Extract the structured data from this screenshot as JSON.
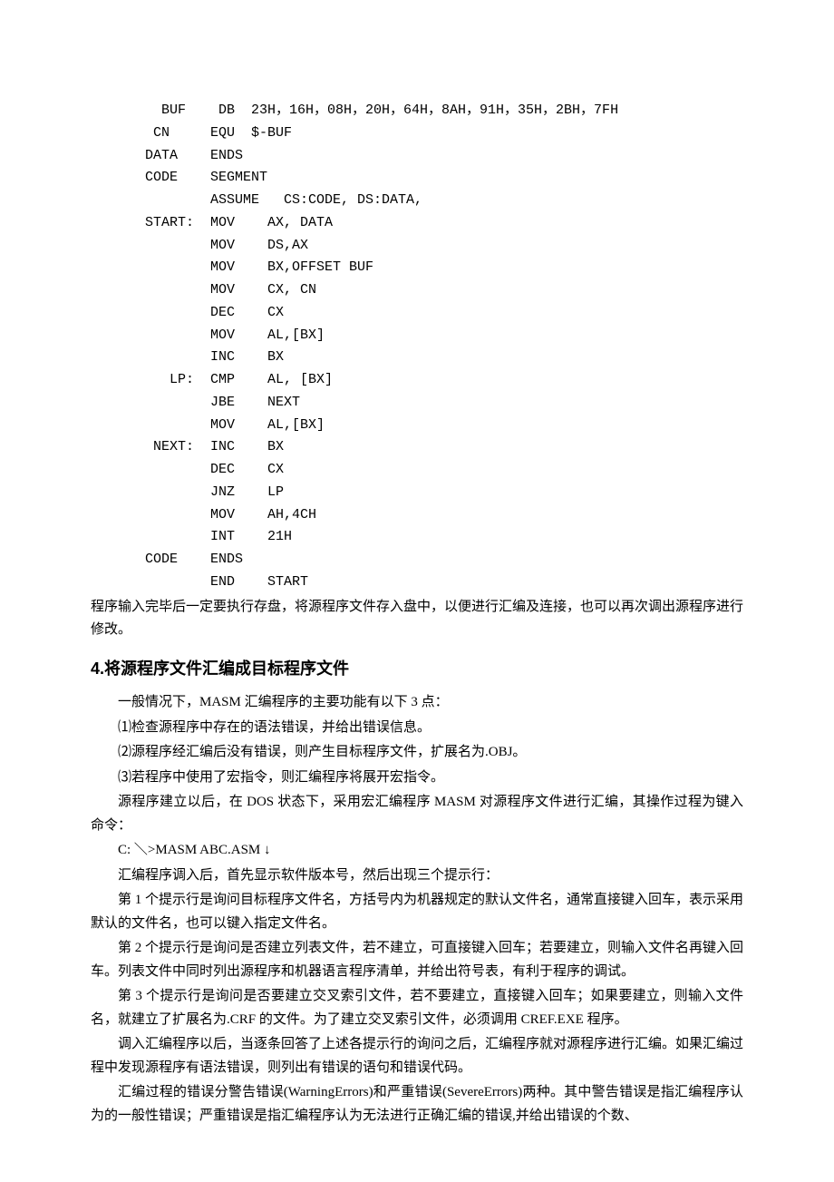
{
  "code": {
    "l1": "  BUF    DB  23H，16H，08H，20H，64H，8AH，91H，35H，2BH，7FH",
    "l2": " CN     EQU  $-BUF",
    "l3": "DATA    ENDS",
    "l4": "CODE    SEGMENT",
    "l5": "        ASSUME   CS:CODE, DS:DATA,",
    "l6": "START:  MOV    AX, DATA",
    "l7": "        MOV    DS,AX",
    "l8": "        MOV    BX,OFFSET BUF",
    "l9": "        MOV    CX, CN",
    "l10": "        DEC    CX",
    "l11": "        MOV    AL,[BX]",
    "l12": "        INC    BX",
    "l13": "   LP:  CMP    AL, [BX]",
    "l14": "        JBE    NEXT",
    "l15": "        MOV    AL,[BX]",
    "l16": " NEXT:  INC    BX",
    "l17": "        DEC    CX",
    "l18": "        JNZ    LP",
    "l19": "        MOV    AH,4CH",
    "l20": "        INT    21H",
    "l21": "CODE    ENDS",
    "l22": "        END    START"
  },
  "p1": "程序输入完毕后一定要执行存盘，将源程序文件存入盘中，以便进行汇编及连接，也可以再次调出源程序进行修改。",
  "h2": "4.将源程序文件汇编成目标程序文件",
  "p2": "一般情况下，MASM 汇编程序的主要功能有以下 3 点：",
  "p3": "⑴检查源程序中存在的语法错误，并给出错误信息。",
  "p4": "⑵源程序经汇编后没有错误，则产生目标程序文件，扩展名为.OBJ。",
  "p5": "⑶若程序中使用了宏指令，则汇编程序将展开宏指令。",
  "p6": "源程序建立以后，在 DOS 状态下，采用宏汇编程序 MASM 对源程序文件进行汇编，其操作过程为键入命令：",
  "p7": "C: ＼>MASM ABC.ASM ↓",
  "p8": "汇编程序调入后，首先显示软件版本号，然后出现三个提示行：",
  "p9": "第 1 个提示行是询问目标程序文件名，方括号内为机器规定的默认文件名，通常直接键入回车，表示采用默认的文件名，也可以键入指定文件名。",
  "p10": "第 2 个提示行是询问是否建立列表文件，若不建立，可直接键入回车；若要建立，则输入文件名再键入回车。列表文件中同时列出源程序和机器语言程序清单，并给出符号表，有利于程序的调试。",
  "p11": "第 3 个提示行是询问是否要建立交叉索引文件，若不要建立，直接键入回车；如果要建立，则输入文件名，就建立了扩展名为.CRF 的文件。为了建立交叉索引文件，必须调用 CREF.EXE 程序。",
  "p12": "调入汇编程序以后，当逐条回答了上述各提示行的询问之后，汇编程序就对源程序进行汇编。如果汇编过程中发现源程序有语法错误，则列出有错误的语句和错误代码。",
  "p13": "汇编过程的错误分警告错误(WarningErrors)和严重错误(SevereErrors)两种。其中警告错误是指汇编程序认为的一般性错误；严重错误是指汇编程序认为无法进行正确汇编的错误,并给出错误的个数、"
}
